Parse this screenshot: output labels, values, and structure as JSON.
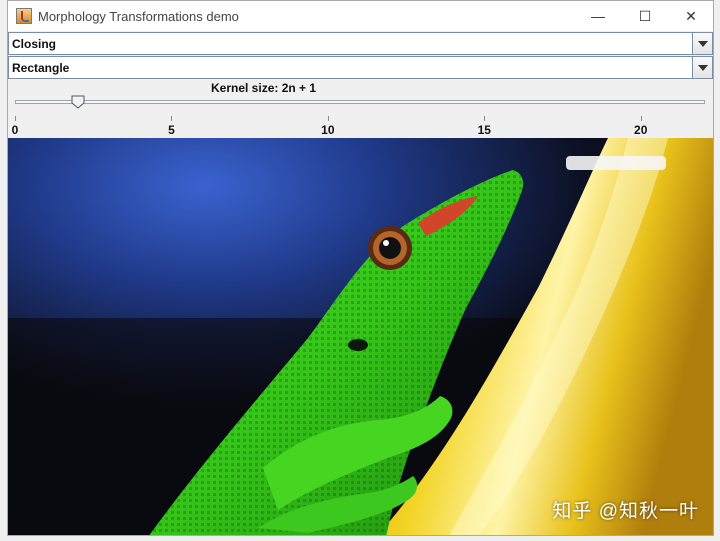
{
  "window": {
    "title": "Morphology Transformations demo",
    "controls": {
      "minimize": "—",
      "maximize": "☐",
      "close": "✕"
    }
  },
  "operation_combo": {
    "selected": "Closing"
  },
  "shape_combo": {
    "selected": "Rectangle"
  },
  "kernel_slider": {
    "label": "Kernel size: 2n + 1",
    "value": 2,
    "min": 0,
    "max": 21,
    "tick_labels": [
      "0",
      "5",
      "10",
      "15",
      "20"
    ],
    "tick_values": [
      0,
      5,
      10,
      15,
      20
    ]
  },
  "image": {
    "subject": "green gecko on yellow surface",
    "watermark": "知乎 @知秋一叶",
    "colors": {
      "gecko": "#3fd11e",
      "background_blue": "#2b4fb0",
      "surface_yellow": "#e8c318"
    }
  }
}
